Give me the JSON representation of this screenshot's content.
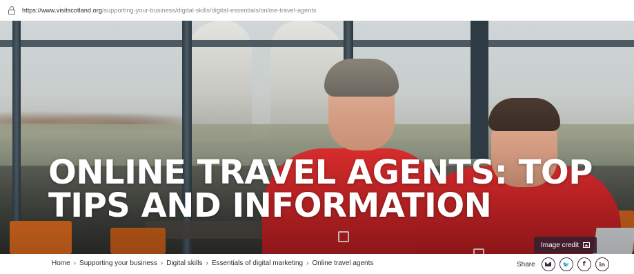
{
  "browser": {
    "url_host": "https://www.visitscotland.org",
    "url_path": "/supporting-your-business/digital-skills/digital-essentials/online-travel-agents"
  },
  "hero": {
    "title_line1": "ONLINE TRAVEL AGENTS: TOP",
    "title_line2": "TIPS AND INFORMATION",
    "image_credit_label": "Image credit"
  },
  "breadcrumb": {
    "items": [
      "Home",
      "Supporting your business",
      "Digital skills",
      "Essentials of digital marketing",
      "Online travel agents"
    ],
    "separator": "›"
  },
  "share": {
    "label": "Share",
    "buttons": [
      {
        "icon": "email-icon"
      },
      {
        "icon": "twitter-icon",
        "glyph": "🐦"
      },
      {
        "icon": "facebook-icon",
        "glyph": "f"
      },
      {
        "icon": "linkedin-icon",
        "glyph": "in"
      }
    ]
  },
  "colors": {
    "accent": "#3a2b3a",
    "credit_bg": "#3c1e2d",
    "jacket_red": "#d82c2c"
  }
}
